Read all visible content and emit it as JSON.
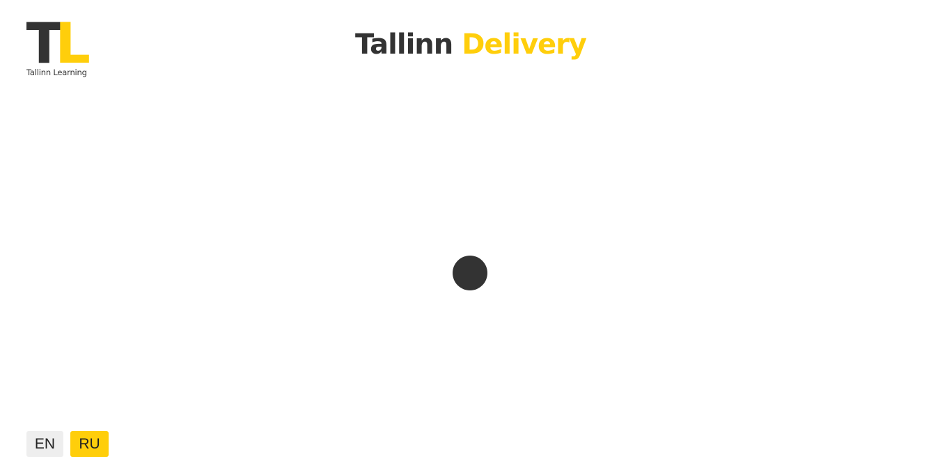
{
  "logo": {
    "letter_t": "T",
    "letter_l": "L",
    "caption": "Tallinn Learning"
  },
  "header": {
    "title_part1": "Tallinn",
    "title_part2": "Delivery"
  },
  "loader": {
    "icon": "loading-spinner-icon"
  },
  "language_switcher": {
    "options": [
      {
        "label": "EN",
        "selected": false
      },
      {
        "label": "RU",
        "selected": true
      }
    ]
  },
  "colors": {
    "accent": "#ffce0b",
    "dark": "#333333",
    "button_inactive": "#eeeeee",
    "background": "#ffffff"
  }
}
